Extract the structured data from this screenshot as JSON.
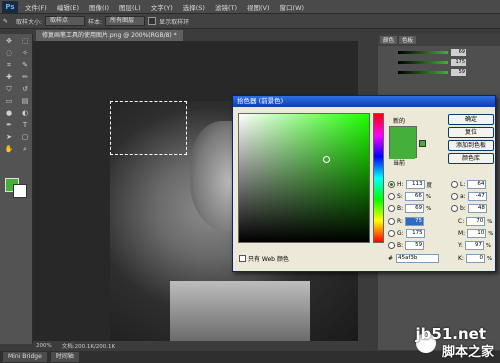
{
  "app": {
    "logo": "Ps"
  },
  "menu": {
    "items": [
      "文件(F)",
      "编辑(E)",
      "图像(I)",
      "图层(L)",
      "文字(Y)",
      "选择(S)",
      "滤镜(T)",
      "视图(V)",
      "窗口(W)"
    ]
  },
  "options": {
    "sample_size_label": "取样大小:",
    "sample_size_value": "取样点",
    "sample_label": "样本:",
    "sample_value": "所有图层",
    "show_ring_label": "显示取样环"
  },
  "document": {
    "tab_title": "修复画笔工具的使用图片.png @ 200%(RGB/8) *",
    "zoom": "200%",
    "doc_info": "文档:200.1K/200.1K"
  },
  "bottom_tabs": [
    "Mini Bridge",
    "时间轴"
  ],
  "panel": {
    "tabs": [
      "颜色",
      "色板"
    ],
    "slider_values": [
      "69",
      "175",
      "59"
    ]
  },
  "color_picker": {
    "title": "拾色器 (前景色)",
    "new_label": "新的",
    "current_label": "当前",
    "buttons": [
      "确定",
      "复位",
      "添加到色板",
      "颜色库"
    ],
    "hsb": [
      {
        "label": "H:",
        "value": "113",
        "unit": "度"
      },
      {
        "label": "S:",
        "value": "66",
        "unit": "%"
      },
      {
        "label": "B:",
        "value": "69",
        "unit": "%"
      }
    ],
    "rgb": [
      {
        "label": "R:",
        "value": "75"
      },
      {
        "label": "G:",
        "value": "175"
      },
      {
        "label": "B:",
        "value": "59"
      }
    ],
    "lab": [
      {
        "label": "L:",
        "value": "64"
      },
      {
        "label": "a:",
        "value": "-47"
      },
      {
        "label": "b:",
        "value": "48"
      }
    ],
    "cmyk": [
      {
        "label": "C:",
        "value": "70",
        "unit": "%"
      },
      {
        "label": "M:",
        "value": "10",
        "unit": "%"
      },
      {
        "label": "Y:",
        "value": "97",
        "unit": "%"
      },
      {
        "label": "K:",
        "value": "0",
        "unit": "%"
      }
    ],
    "web_only_label": "只有 Web 颜色",
    "hex_label": "#",
    "hex_value": "45af3b",
    "color": "#45af3b"
  },
  "watermark": {
    "site": "jb51.net",
    "brand": "脚本之家"
  }
}
